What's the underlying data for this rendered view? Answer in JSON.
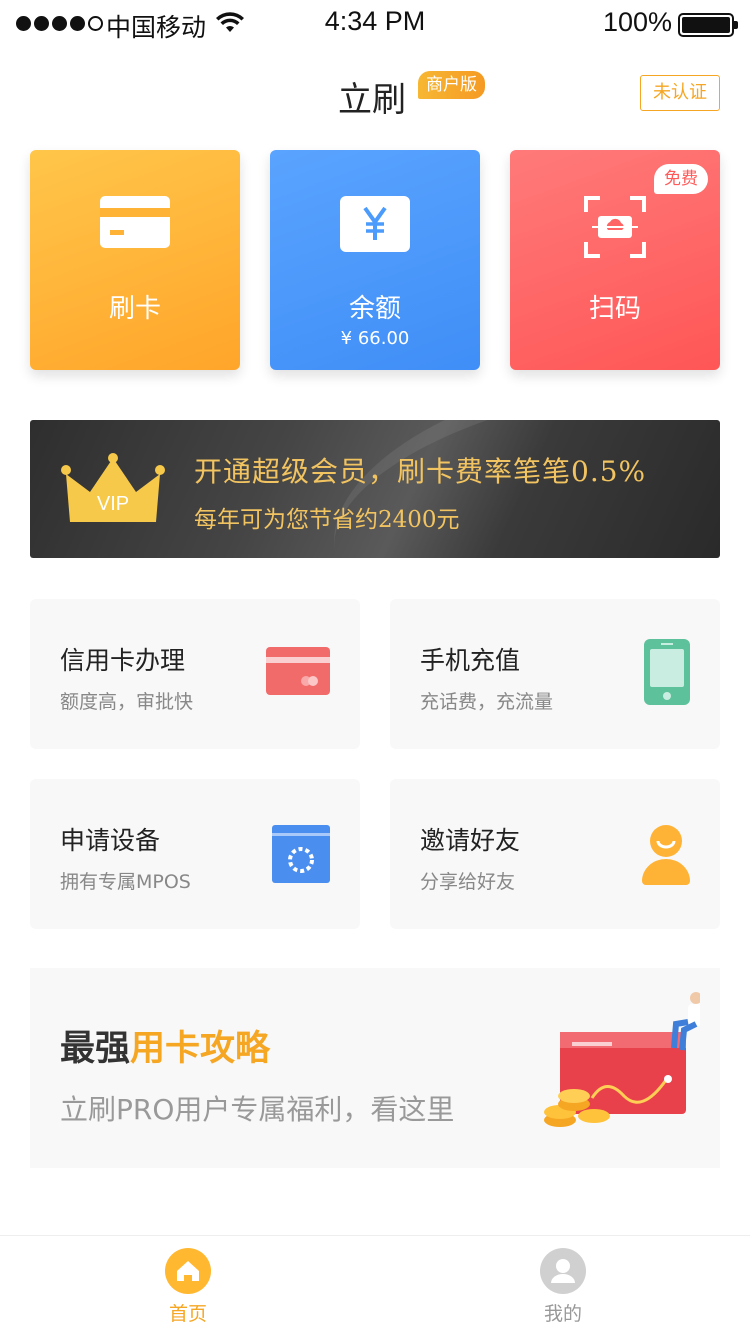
{
  "status_bar": {
    "carrier": "中国移动",
    "time": "4:34 PM",
    "battery": "100%"
  },
  "header": {
    "title": "立刷",
    "edition_badge": "商户版",
    "verify_label": "未认证"
  },
  "quick_actions": [
    {
      "label": "刷卡",
      "icon": "card-icon",
      "color": "#ffb336"
    },
    {
      "label": "余额",
      "amount": "¥ 66.00",
      "icon": "yuan-icon",
      "color": "#4a9bfb"
    },
    {
      "label": "扫码",
      "badge": "免费",
      "icon": "scan-icon",
      "color": "#ff6464"
    }
  ],
  "vip_banner": {
    "crown_text": "VIP",
    "line1": "开通超级会员，刷卡费率笔笔0.5%",
    "line2": "每年可为您节省约2400元"
  },
  "services": [
    {
      "title": "信用卡办理",
      "subtitle": "额度高，审批快",
      "icon": "credit-card-icon",
      "color": "#f26b6b"
    },
    {
      "title": "手机充值",
      "subtitle": "充话费，充流量",
      "icon": "phone-icon",
      "color": "#5dc19c"
    },
    {
      "title": "申请设备",
      "subtitle": "拥有专属MPOS",
      "icon": "pos-device-icon",
      "color": "#4a8ef0"
    },
    {
      "title": "邀请好友",
      "subtitle": "分享给好友",
      "icon": "friend-icon",
      "color": "#ffb336"
    }
  ],
  "guide_banner": {
    "title_prefix": "最强",
    "title_highlight": "用卡攻略",
    "subtitle": "立刷PRO用户专属福利，看这里"
  },
  "tab_bar": [
    {
      "label": "首页",
      "icon": "home-icon",
      "active": true
    },
    {
      "label": "我的",
      "icon": "profile-icon",
      "active": false
    }
  ],
  "colors": {
    "accent": "#f5a623"
  }
}
